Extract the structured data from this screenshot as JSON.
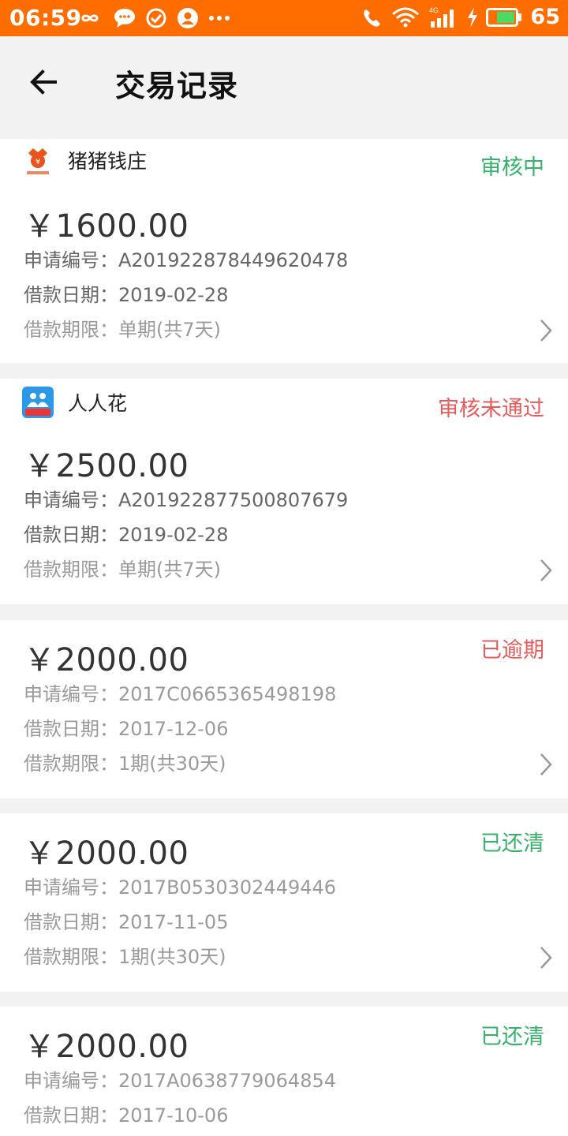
{
  "status_bar": {
    "time": "06:59",
    "battery": "65",
    "network": "4G"
  },
  "header": {
    "title": "交易记录"
  },
  "records": [
    {
      "brand": "猪猪钱庄",
      "status": "审核中",
      "amount": "￥1600.00",
      "apply_no": "申请编号：A201922878449620478",
      "loan_date": "借款日期：2019-02-28",
      "term": "借款期限：单期(共7天)"
    },
    {
      "brand": "人人花",
      "status": "审核未通过",
      "amount": "￥2500.00",
      "apply_no": "申请编号：A201922877500807679",
      "loan_date": "借款日期：2019-02-28",
      "term": "借款期限：单期(共7天)"
    },
    {
      "status": "已逾期",
      "amount": "￥2000.00",
      "apply_no": "申请编号：2017C0665365498198",
      "loan_date": "借款日期：2017-12-06",
      "term": "借款期限：1期(共30天)"
    },
    {
      "status": "已还清",
      "amount": "￥2000.00",
      "apply_no": "申请编号：2017B0530302449446",
      "loan_date": "借款日期：2017-11-05",
      "term": "借款期限：1期(共30天)"
    },
    {
      "status": "已还清",
      "amount": "￥2000.00",
      "apply_no": "申请编号：2017A0638779064854",
      "loan_date": "借款日期：2017-10-06"
    }
  ],
  "colors": {
    "status_bar": "#ff6d00",
    "status_green": "#35b36b",
    "status_red": "#ea5a5a"
  },
  "icons": {
    "back": "arrow-left-icon",
    "chevron": "chevron-right-icon"
  }
}
